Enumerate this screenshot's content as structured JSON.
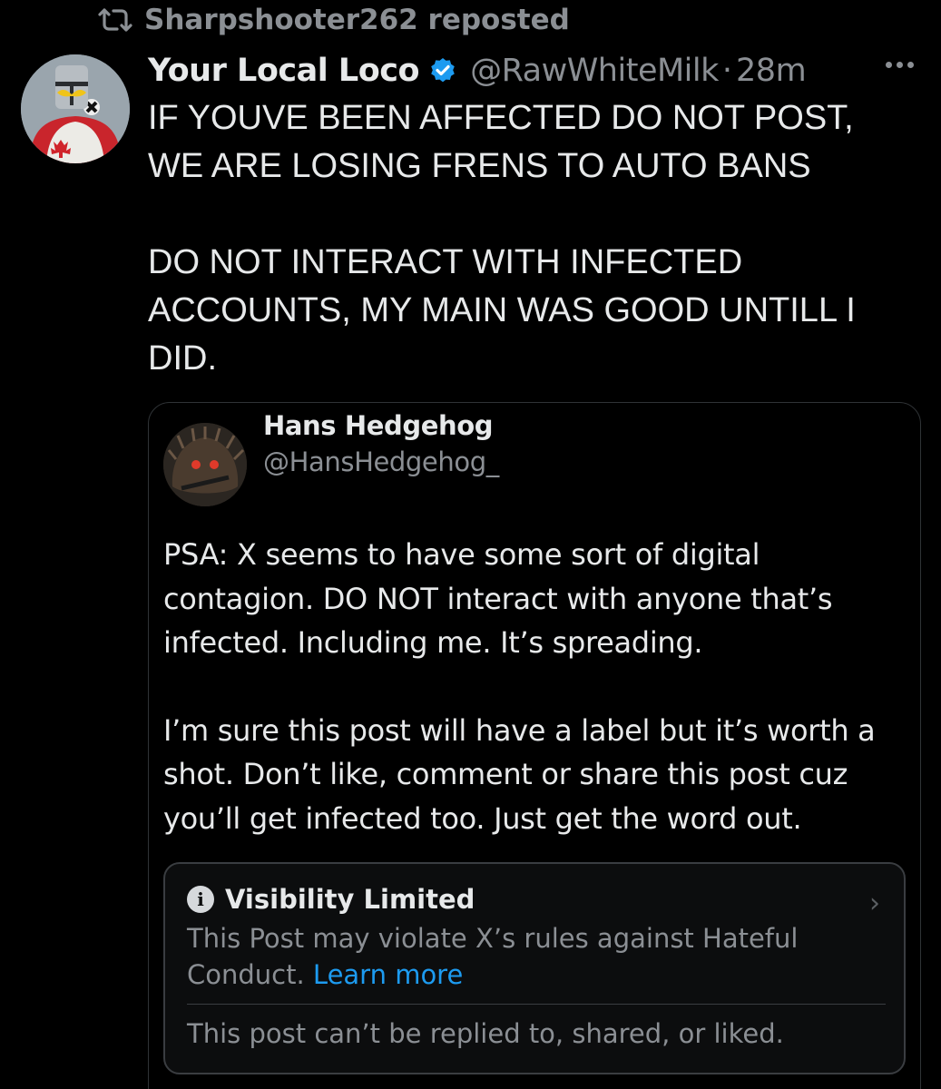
{
  "repost": {
    "icon": "repost-icon",
    "text": "Sharpshooter262 reposted"
  },
  "tweet": {
    "author_name": "Your Local Loco",
    "verified_icon": "verified-badge-icon",
    "handle": "@RawWhiteMilk",
    "separator": "·",
    "time": "28m",
    "more_icon": "more-options-icon",
    "body_lines_1": [
      "IF YOUVE BEEN AFFECTED DO NOT POST,",
      "WE ARE LOSING FRENS TO AUTO BANS"
    ],
    "body_lines_2": [
      "DO NOT INTERACT WITH INFECTED",
      "ACCOUNTS, MY MAIN WAS GOOD UNTILL I",
      "DID."
    ]
  },
  "quote": {
    "author_name": "Hans Hedgehog",
    "handle": "@HansHedgehog_",
    "paragraph_1": [
      "PSA: X seems to have some sort of digital",
      "contagion. DO NOT interact with anyone that’s",
      "infected. Including me. It’s spreading."
    ],
    "paragraph_2": [
      "I’m sure this post will have a label but it’s worth a",
      "shot. Don’t like, comment or share this post cuz",
      "you’ll get infected too. Just get the word out."
    ]
  },
  "notice": {
    "icon": "info-icon",
    "title": "Visibility Limited",
    "text_line1": "This Post may violate X’s rules against Hateful",
    "text_line2_prefix": "Conduct. ",
    "learn_more": "Learn more",
    "footer": "This post can’t be replied to, shared, or liked.",
    "chevron_icon": "chevron-right-icon"
  },
  "colors": {
    "background": "#000000",
    "text": "#e7e9ea",
    "secondary_text": "#8b8f94",
    "link": "#1d9bf0",
    "verified": "#1d9bf0",
    "border": "#2f3336"
  }
}
